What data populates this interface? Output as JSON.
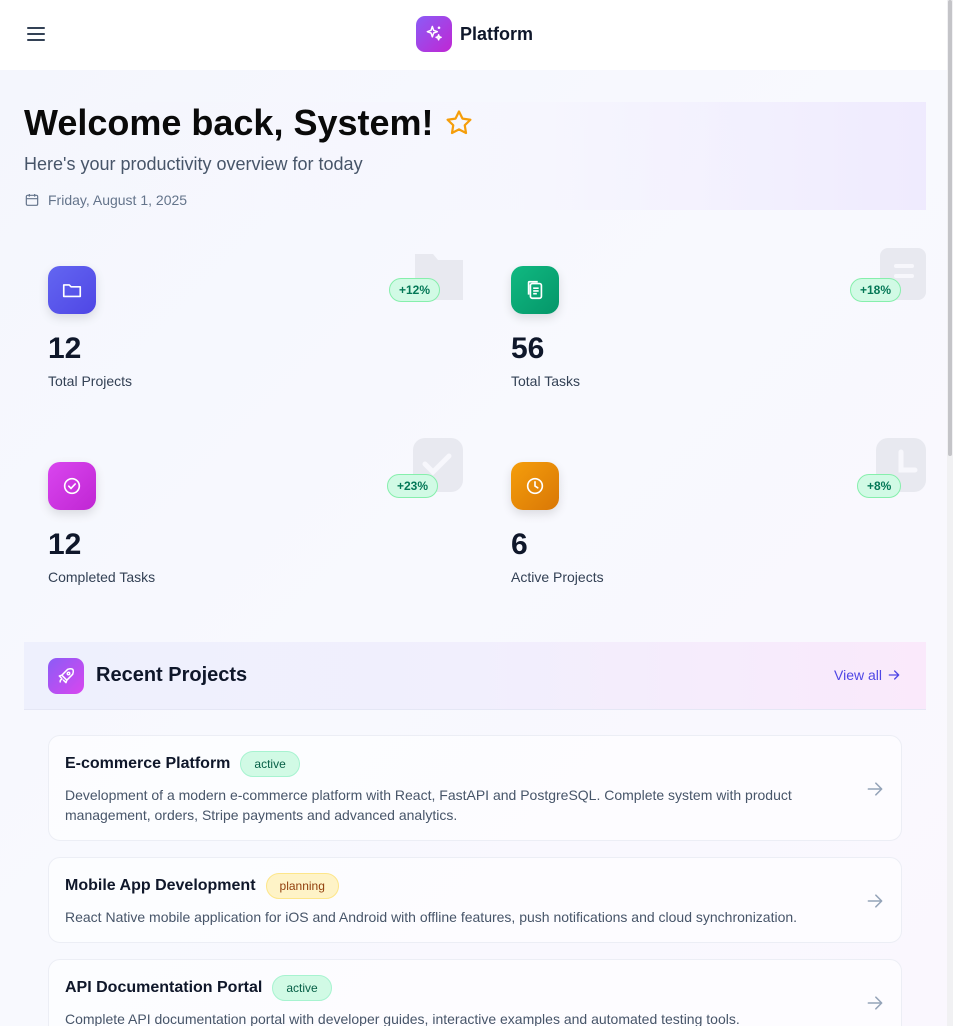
{
  "header": {
    "brand_name": "Platform",
    "brand_icon": "sparkles-icon",
    "menu_icon": "hamburger-menu-icon"
  },
  "welcome": {
    "title": "Welcome back, System!",
    "subtitle": "Here's your productivity overview for today",
    "date": "Friday, August 1, 2025"
  },
  "stats": [
    {
      "value": "12",
      "label": "Total Projects",
      "change": "+12%",
      "icon": "folder-icon",
      "color": "#6366f1"
    },
    {
      "value": "56",
      "label": "Total Tasks",
      "change": "+18%",
      "icon": "clipboard-icon",
      "color": "#10b981"
    },
    {
      "value": "12",
      "label": "Completed Tasks",
      "change": "+23%",
      "icon": "check-circle-icon",
      "color": "#c026d3"
    },
    {
      "value": "6",
      "label": "Active Projects",
      "change": "+8%",
      "icon": "clock-icon",
      "color": "#f59e0b"
    }
  ],
  "recent": {
    "title": "Recent Projects",
    "view_all": "View all",
    "projects": [
      {
        "name": "E-commerce Platform",
        "status": "active",
        "description": "Development of a modern e-commerce platform with React, FastAPI and PostgreSQL. Complete system with product management, orders, Stripe payments and advanced analytics."
      },
      {
        "name": "Mobile App Development",
        "status": "planning",
        "description": "React Native mobile application for iOS and Android with offline features, push notifications and cloud synchronization."
      },
      {
        "name": "API Documentation Portal",
        "status": "active",
        "description": "Complete API documentation portal with developer guides, interactive examples and automated testing tools."
      }
    ]
  }
}
